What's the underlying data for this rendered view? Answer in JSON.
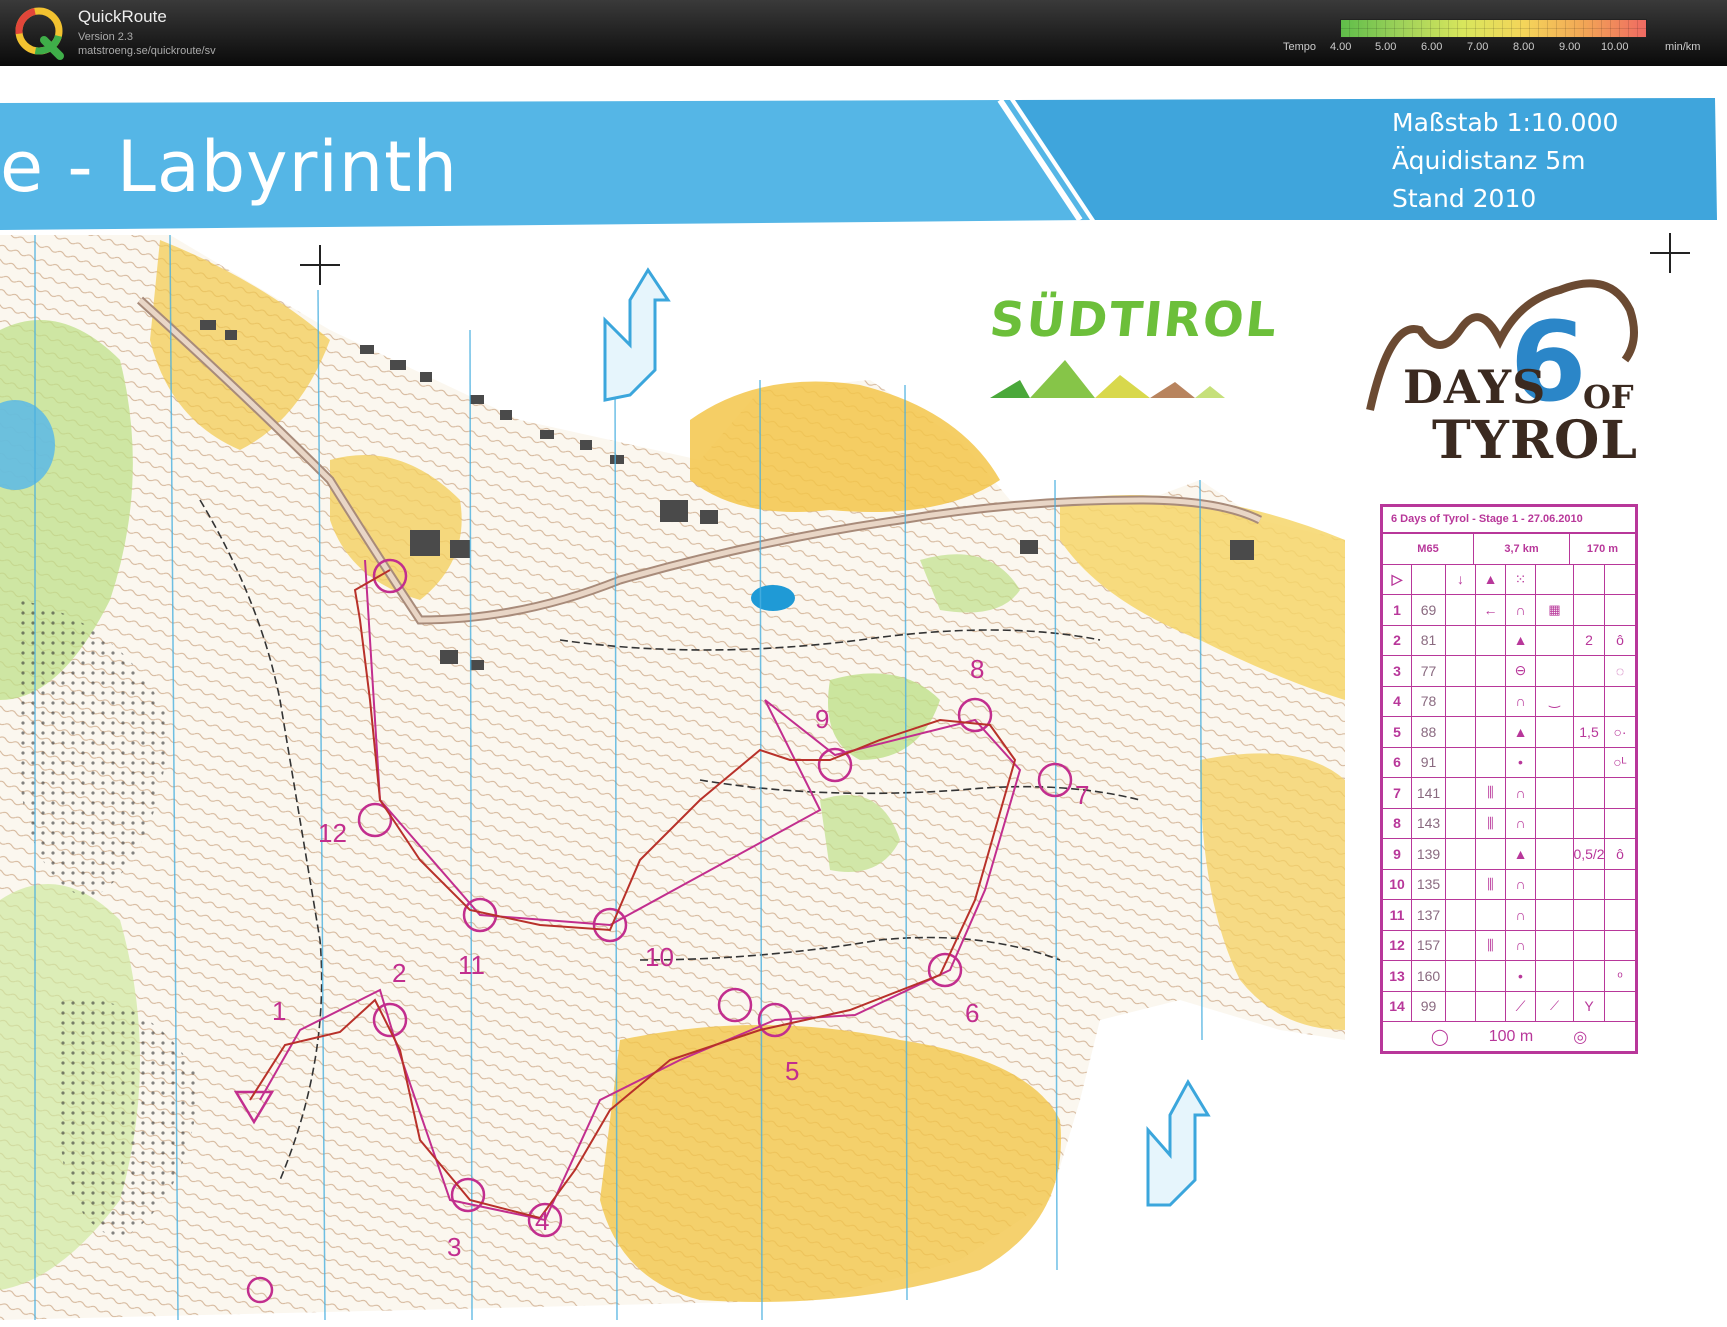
{
  "app": {
    "name": "QuickRoute",
    "version": "Version 2.3",
    "url": "matstroeng.se/quickroute/sv"
  },
  "tempo_legend": {
    "label": "Tempo",
    "ticks": [
      "4.00",
      "5.00",
      "6.00",
      "7.00",
      "8.00",
      "9.00",
      "10.00"
    ],
    "unit": "min/km",
    "colors": [
      "#5fbd4a",
      "#9fd25a",
      "#d8e65c",
      "#f4d55a",
      "#f2a556",
      "#ef6a62"
    ]
  },
  "map": {
    "title": "e - Labyrinth",
    "scale_lines": [
      "Maßstab 1:10.000",
      "Äquidistanz 5m",
      "Stand 2010"
    ],
    "region_logo": "SÜDTIROL",
    "event_logo": {
      "line1": "DAYS",
      "of": "OF",
      "line2": "TYROL",
      "numeral": "6"
    },
    "colors": {
      "banner": "#4fb3e6",
      "course": "#c22e8e",
      "route": "#c0322e",
      "open_land": "#f2c94c",
      "forest": "#bfe08a"
    }
  },
  "control_description": {
    "title": "6 Days of Tyrol - Stage 1 - 27.06.2010",
    "class": "M65",
    "length": "3,7 km",
    "climb": "170 m",
    "rows": [
      {
        "n": "1",
        "code": "69",
        "c4": "←",
        "c5": "∩",
        "c6": "▦",
        "c8": ""
      },
      {
        "n": "2",
        "code": "81",
        "c4": "",
        "c5": "▲",
        "c6": "",
        "c7": "2",
        "c8": "ô"
      },
      {
        "n": "3",
        "code": "77",
        "c4": "",
        "c5": "⊖",
        "c6": "",
        "c8": "◌"
      },
      {
        "n": "4",
        "code": "78",
        "c4": "",
        "c5": "∩",
        "c6": "‿",
        "c8": ""
      },
      {
        "n": "5",
        "code": "88",
        "c4": "",
        "c5": "▲",
        "c6": "",
        "c7": "1,5",
        "c8": "○·"
      },
      {
        "n": "6",
        "code": "91",
        "c4": "",
        "c5": "•",
        "c6": "",
        "c8": "○ᴸ"
      },
      {
        "n": "7",
        "code": "141",
        "c4": "⫼",
        "c5": "∩",
        "c6": "",
        "c8": ""
      },
      {
        "n": "8",
        "code": "143",
        "c4": "⫼",
        "c5": "∩",
        "c6": "",
        "c8": ""
      },
      {
        "n": "9",
        "code": "139",
        "c4": "",
        "c5": "▲",
        "c6": "",
        "c7": "0,5/2",
        "c8": "ô"
      },
      {
        "n": "10",
        "code": "135",
        "c4": "⫼",
        "c5": "∩",
        "c6": "",
        "c8": ""
      },
      {
        "n": "11",
        "code": "137",
        "c4": "",
        "c5": "∩",
        "c6": "",
        "c8": ""
      },
      {
        "n": "12",
        "code": "157",
        "c4": "⫼",
        "c5": "∩",
        "c6": "",
        "c8": ""
      },
      {
        "n": "13",
        "code": "160",
        "c4": "",
        "c5": "•",
        "c6": "",
        "c8": "ᵒ"
      },
      {
        "n": "14",
        "code": "99",
        "c4": "",
        "c5": "⟋",
        "c6": "⟋",
        "c7": "Y",
        "c8": ""
      }
    ],
    "finish": "100 m"
  },
  "control_numbers": [
    "1",
    "2",
    "3",
    "4",
    "5",
    "6",
    "7",
    "8",
    "9",
    "10",
    "11",
    "12"
  ]
}
